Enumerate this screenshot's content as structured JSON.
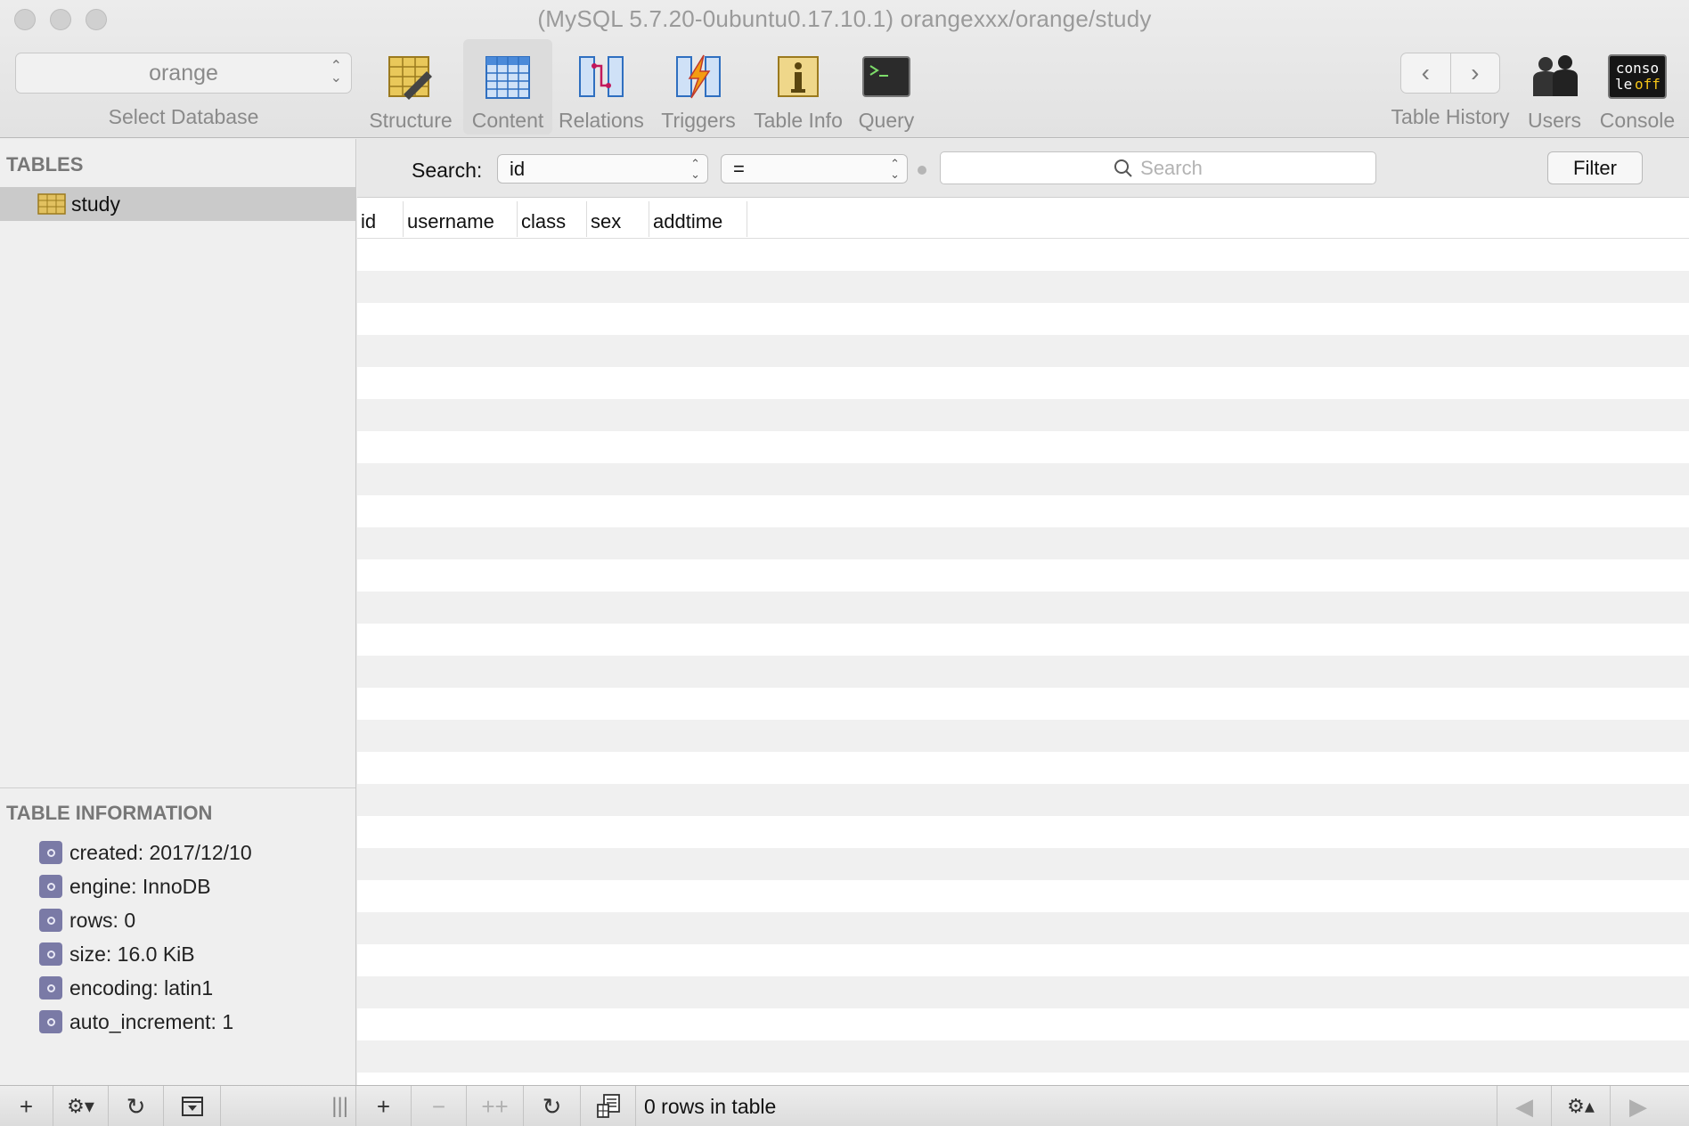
{
  "window": {
    "title": "(MySQL 5.7.20-0ubuntu0.17.10.1) orangexxx/orange/study"
  },
  "toolbar": {
    "database_value": "orange",
    "database_caption": "Select Database",
    "items": [
      {
        "label": "Structure",
        "icon": "structure-icon"
      },
      {
        "label": "Content",
        "icon": "content-icon",
        "active": true
      },
      {
        "label": "Relations",
        "icon": "relations-icon"
      },
      {
        "label": "Triggers",
        "icon": "triggers-icon"
      },
      {
        "label": "Table Info",
        "icon": "table-info-icon"
      },
      {
        "label": "Query",
        "icon": "query-icon"
      }
    ],
    "history_label": "Table History",
    "users_label": "Users",
    "console_label": "Console",
    "console_icon_text_top": "conso",
    "console_icon_text_bottom_a": "le",
    "console_icon_text_bottom_b": "off"
  },
  "sidebar": {
    "tables_heading": "TABLES",
    "tables": [
      "study"
    ],
    "info_heading": "TABLE INFORMATION",
    "info": [
      "created: 2017/12/10",
      "engine: InnoDB",
      "rows: 0",
      "size: 16.0 KiB",
      "encoding: latin1",
      "auto_increment: 1"
    ]
  },
  "filter": {
    "label": "Search:",
    "field_value": "id",
    "operator_value": "=",
    "search_placeholder": "Search",
    "button_label": "Filter"
  },
  "grid": {
    "columns": [
      "id",
      "username",
      "class",
      "sex",
      "addtime"
    ]
  },
  "status": {
    "rows_text": "0 rows in table"
  },
  "colors": {
    "selected_row": "#cacaca",
    "info_bullet": "#7a7aa6",
    "structure_icon": "#e9c85a",
    "content_icon": "#4b8ad9"
  }
}
